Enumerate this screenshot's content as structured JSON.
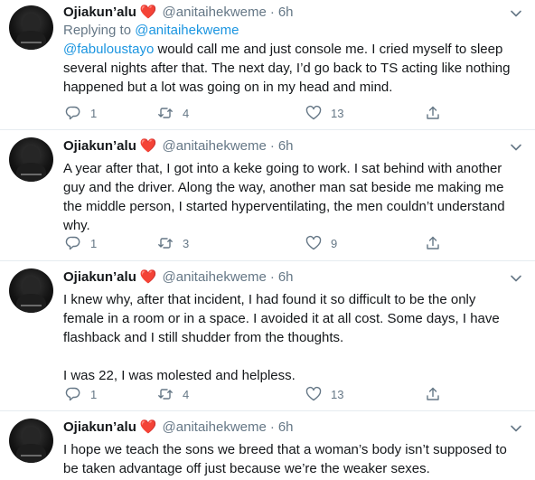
{
  "tweets": [
    {
      "name": "Ojiakun’alu",
      "emoji": "❤️",
      "handle": "@anitaihekweme",
      "separator": "·",
      "time": "6h",
      "replying_prefix": "Replying to ",
      "replying_handle": "@anitaihekweme",
      "mention": "@fabuloustayo",
      "text": " would call me and just console me. I cried myself to sleep several nights after that.  The next day, I’d go back to TS acting like nothing happened but a lot was going on in my head and mind.",
      "replies": "1",
      "retweets": "4",
      "likes": "13"
    },
    {
      "name": "Ojiakun’alu",
      "emoji": "❤️",
      "handle": "@anitaihekweme",
      "separator": "·",
      "time": "6h",
      "text": "A year after that, I got into a keke going to work. I sat behind with another guy and the driver. Along the way, another man sat beside me making me the middle person, I started hyperventilating, the men couldn’t understand why.",
      "replies": "1",
      "retweets": "3",
      "likes": "9"
    },
    {
      "name": "Ojiakun’alu",
      "emoji": "❤️",
      "handle": "@anitaihekweme",
      "separator": "·",
      "time": "6h",
      "text": "I knew why, after that incident, I had found it so difficult to be the only female in a room or in a space. I avoided it at all cost. Some days, I have flashback and I still shudder from the thoughts.",
      "text2": "I was 22, I was molested and helpless.",
      "replies": "1",
      "retweets": "4",
      "likes": "13"
    },
    {
      "name": "Ojiakun’alu",
      "emoji": "❤️",
      "handle": "@anitaihekweme",
      "separator": "·",
      "time": "6h",
      "text": "I hope we teach the sons we breed that a woman’s body isn’t supposed to be taken advantage off just because we’re the weaker sexes."
    }
  ],
  "icons": {
    "reply": "reply-icon",
    "retweet": "retweet-icon",
    "like": "heart-icon",
    "share": "share-icon",
    "more": "chevron-down-icon"
  },
  "colors": {
    "accent": "#1b95e0",
    "secondary_text": "#657786",
    "heart": "#e0245e",
    "divider": "#e6ecf0"
  }
}
